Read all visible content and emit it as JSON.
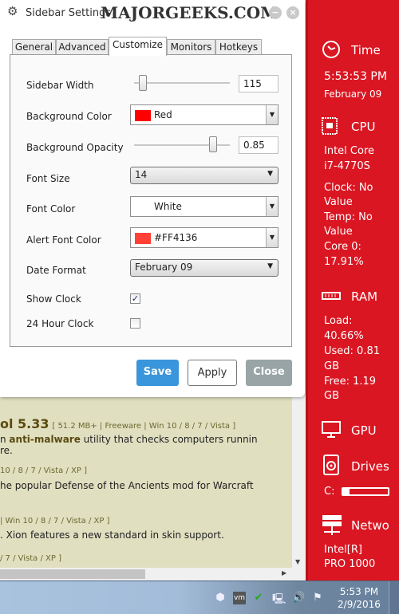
{
  "dialog": {
    "title": "Sidebar Settings",
    "watermark": "MAJORGEEKS.COM",
    "tabs": [
      {
        "label": "General"
      },
      {
        "label": "Advanced"
      },
      {
        "label": "Customize"
      },
      {
        "label": "Monitors"
      },
      {
        "label": "Hotkeys"
      }
    ],
    "active_tab": "Customize",
    "fields": {
      "sidebar_width": {
        "label": "Sidebar Width",
        "value": "115",
        "slider_fraction": 0.05
      },
      "background_color": {
        "label": "Background Color",
        "value": "Red",
        "swatch": "#FF0000"
      },
      "background_opacity": {
        "label": "Background Opacity",
        "value": "0.85",
        "slider_fraction": 0.85
      },
      "font_size": {
        "label": "Font Size",
        "value": "14"
      },
      "font_color": {
        "label": "Font Color",
        "value": "White",
        "swatch": "#FFFFFF"
      },
      "alert_font_color": {
        "label": "Alert Font Color",
        "value": "#FF4136",
        "swatch": "#FF4136"
      },
      "date_format": {
        "label": "Date Format",
        "value": "February 09"
      },
      "show_clock": {
        "label": "Show Clock",
        "checked": true
      },
      "hour24_clock": {
        "label": "24 Hour Clock",
        "checked": false
      }
    },
    "buttons": {
      "save": "Save",
      "apply": "Apply",
      "close": "Close"
    }
  },
  "background_page": {
    "l1_title": "ol 5.33",
    "l1_meta": "[ 51.2 MB+ | Freeware | Win 10 / 8 / 7 / Vista ]",
    "l2a": "n ",
    "l2b": "anti-malware",
    "l2c": " utility that checks computers runnin",
    "l3": "re.",
    "l4": "10 / 8 / 7 / Vista / XP ]",
    "l5": "he popular Defense of the Ancients mod for Warcraft",
    "l6": "| Win 10 / 8 / 7 / Vista / XP ]",
    "l7": ". Xion features a new standard in skin support.",
    "l8": "/ 7 / Vista / XP ]"
  },
  "sidebar": {
    "accent": "#DA1622",
    "time": {
      "heading": "Time",
      "clock": "5:53:53 PM",
      "date": "February 09"
    },
    "cpu": {
      "heading": "CPU",
      "lines": [
        "Intel Core",
        "i7-4770S",
        "Clock: No",
        "Value",
        "Temp: No",
        "Value",
        "Core 0:",
        "17.91%"
      ]
    },
    "ram": {
      "heading": "RAM",
      "lines": [
        "Load:",
        "40.66%",
        "Used: 0.81",
        "GB",
        "Free: 1.19",
        "GB"
      ]
    },
    "gpu": {
      "heading": "GPU"
    },
    "drives": {
      "heading": "Drives",
      "drive_label": "C:",
      "usage_fraction": 0.15
    },
    "network": {
      "heading": "Netwo",
      "lines": [
        "Intel[R]",
        "PRO 1000"
      ]
    }
  },
  "taskbar": {
    "time": "5:53 PM",
    "date": "2/9/2016"
  }
}
